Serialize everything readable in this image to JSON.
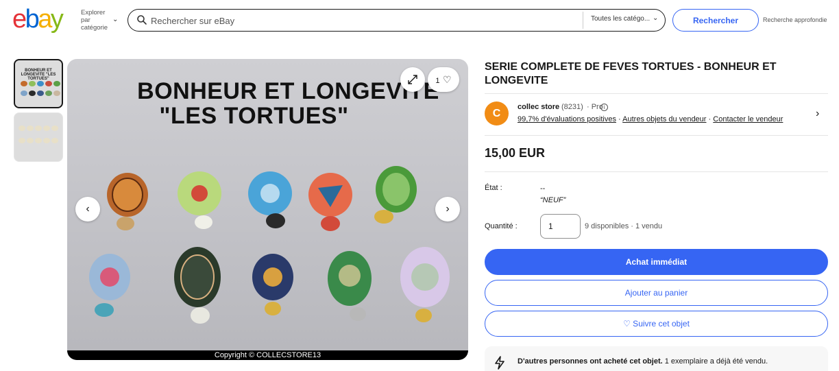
{
  "header": {
    "logo_letters": [
      "e",
      "b",
      "a",
      "y"
    ],
    "category_button": {
      "line1": "Explorer",
      "line2": "par",
      "line3": "catégorie"
    },
    "search": {
      "placeholder": "Rechercher sur eBay",
      "category": "Toutes les catégo..."
    },
    "search_button": "Rechercher",
    "advanced": "Recherche approfondie"
  },
  "gallery": {
    "thumb1_title": "BONHEUR ET LONGEVITE \"LES TORTUES\"",
    "image_title_line1": "BONHEUR ET LONGEVITE",
    "image_title_line2": "\"LES TORTUES\"",
    "copyright": "Copyright © COLLECSTORE13",
    "watch_count": "1"
  },
  "item": {
    "title": "SERIE COMPLETE DE FEVES TORTUES - BONHEUR ET LONGEVITE",
    "seller": {
      "avatar_letter": "C",
      "name": "collec store",
      "feedback_count": "(8231)",
      "badge": "· Pro",
      "positive": "99,7% d'évaluations positives",
      "other_items": "Autres objets du vendeur",
      "contact": "Contacter le vendeur"
    },
    "price": "15,00 EUR",
    "condition_label": "État :",
    "condition_value": "--",
    "condition_note": "“NEUF”",
    "quantity_label": "Quantité :",
    "quantity_value": "1",
    "availability": "9 disponibles · 1 vendu",
    "buy_now": "Achat immédiat",
    "add_to_cart": "Ajouter au panier",
    "watch": "♡ Suivre cet objet",
    "notice_bold": "D'autres personnes ont acheté cet objet.",
    "notice_rest": " 1 exemplaire a déjà été vendu."
  },
  "colors": {
    "accent": "#3665f3",
    "avatar": "#f18c15"
  }
}
